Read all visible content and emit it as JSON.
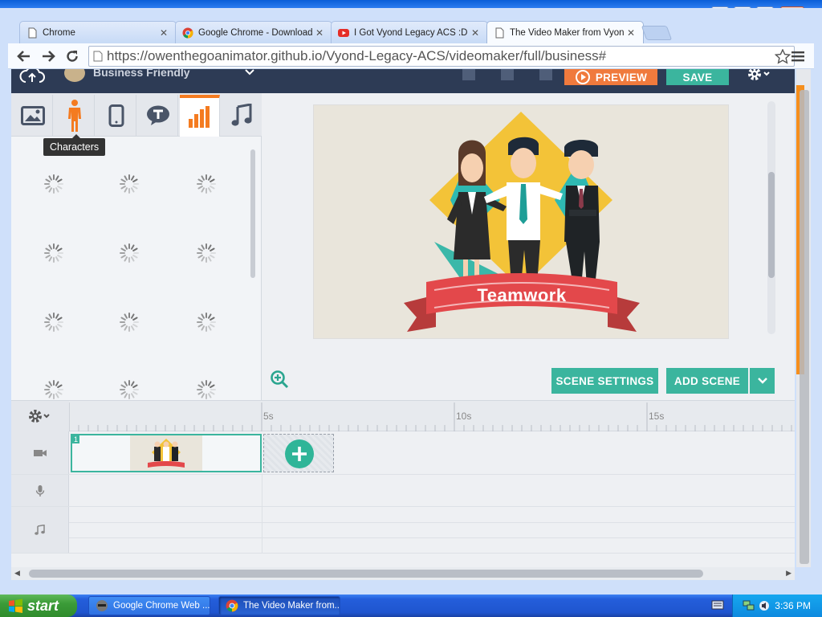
{
  "window": {
    "title": "Google Chrome Web Browser — Vyond"
  },
  "tabs": [
    {
      "label": "Chrome",
      "icon": "document-icon",
      "active": false
    },
    {
      "label": "Google Chrome - Download t",
      "icon": "chrome-icon",
      "active": false
    },
    {
      "label": "I Got Vyond Legacy ACS :D c",
      "icon": "youtube-icon",
      "active": false
    },
    {
      "label": "The Video Maker from Vyond",
      "icon": "document-icon",
      "active": true
    }
  ],
  "address_bar": {
    "url": "https://owenthegoanimator.github.io/Vyond-Legacy-ACS/videomaker/full/business#"
  },
  "app": {
    "theme_name": "Business Friendly",
    "preview_label": "PREVIEW",
    "save_label": "SAVE",
    "asset_tabs": [
      {
        "name": "image",
        "icon": "image-icon"
      },
      {
        "name": "characters",
        "icon": "character-icon"
      },
      {
        "name": "props",
        "icon": "phone-icon"
      },
      {
        "name": "text",
        "icon": "speech-bubble-icon"
      },
      {
        "name": "charts",
        "icon": "bar-chart-icon",
        "selected": true
      },
      {
        "name": "audio",
        "icon": "music-note-icon"
      }
    ],
    "tooltip": "Characters",
    "scene_title": "Teamwork",
    "scene_settings_label": "SCENE SETTINGS",
    "add_scene_label": "ADD SCENE",
    "timeline": {
      "ruler_labels": [
        "5s",
        "10s",
        "15s"
      ],
      "scene_number": "1"
    }
  },
  "taskbar": {
    "start_label": "start",
    "tasks": [
      {
        "label": "Google Chrome Web ...",
        "active": false
      },
      {
        "label": "The Video Maker from...",
        "active": true
      }
    ],
    "clock": "3:36 PM"
  }
}
